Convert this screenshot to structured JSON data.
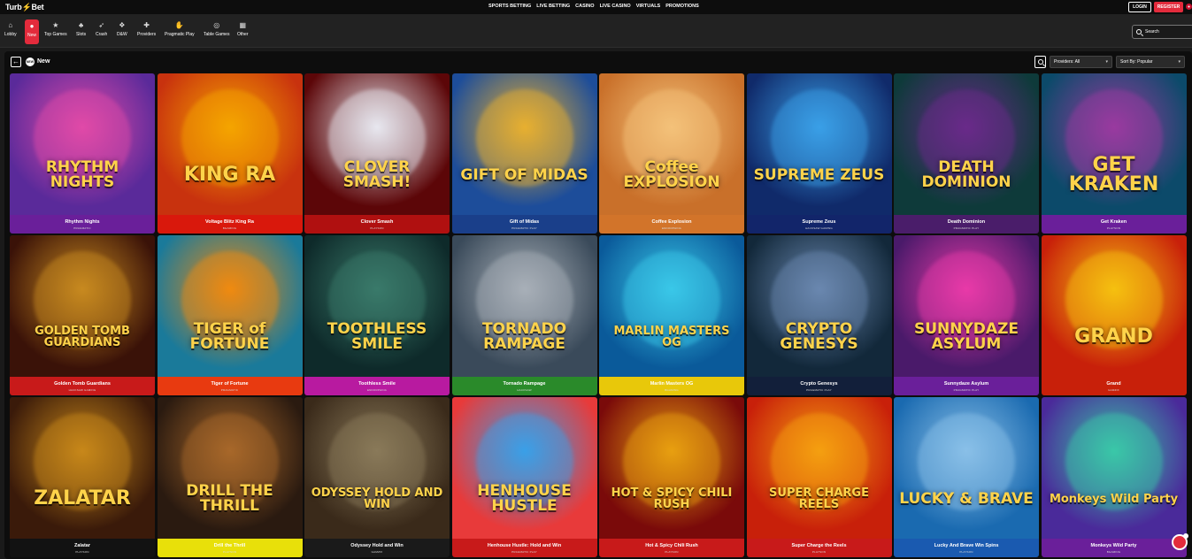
{
  "brand": {
    "name_a": "Turb",
    "name_b": "Bet"
  },
  "topnav": [
    "SPORTS BETTING",
    "LIVE BETTING",
    "CASINO",
    "LIVE CASINO",
    "VIRTUALS",
    "PROMOTIONS"
  ],
  "auth": {
    "login": "LOGIN",
    "register": "REGISTER"
  },
  "categories": [
    {
      "label": "Lobby",
      "icon": "home-icon"
    },
    {
      "label": "New",
      "icon": "new-icon",
      "active": true
    },
    {
      "label": "Top Games",
      "icon": "star-icon"
    },
    {
      "label": "Slots",
      "icon": "slots-icon"
    },
    {
      "label": "Crash",
      "icon": "rocket-icon"
    },
    {
      "label": "D&W",
      "icon": "gift-icon"
    },
    {
      "label": "Providers",
      "icon": "providers-icon"
    },
    {
      "label": "Pragmatic Play",
      "icon": "pragmatic-icon"
    },
    {
      "label": "Table Games",
      "icon": "chip-icon"
    },
    {
      "label": "Other",
      "icon": "other-icon"
    }
  ],
  "search": {
    "placeholder": "Search"
  },
  "section": {
    "title": "New",
    "badge": "NEW"
  },
  "filters": {
    "providers": "Providers: All",
    "sort": "Sort By: Popular"
  },
  "games": [
    {
      "name": "Rhythm Nights",
      "provider": "Pragmatic",
      "logo": "RHYTHM NIGHTS",
      "bg": "#5a2a9a",
      "bg2": "#e14aa8",
      "cap": "#6a1f9a"
    },
    {
      "name": "Voltage Blitz King Ra",
      "provider": "Bgaming",
      "logo": "KING RA",
      "bg": "#c8320e",
      "bg2": "#f5a500",
      "cap": "#d9180c"
    },
    {
      "name": "Clover Smash",
      "provider": "Playson",
      "logo": "CLOVER SMASH!",
      "bg": "#5c0608",
      "bg2": "#e8e8f0",
      "cap": "#b01010"
    },
    {
      "name": "Gift of Midas",
      "provider": "Pragmatic Play",
      "logo": "GIFT OF MIDAS",
      "bg": "#1d4d9a",
      "bg2": "#e8b030",
      "cap": "#1a3f8a"
    },
    {
      "name": "Coffee Explosion",
      "provider": "Endorphina",
      "logo": "Coffee EXPLOSION",
      "bg": "#c9702a",
      "bg2": "#f4c27a",
      "cap": "#d2742a"
    },
    {
      "name": "Supreme Zeus",
      "provider": "Hacksaw Gaming",
      "logo": "SUPREME ZEUS",
      "bg": "#102a6a",
      "bg2": "#3aa0e8",
      "cap": "#12256a"
    },
    {
      "name": "Death Dominion",
      "provider": "Pragmatic Play",
      "logo": "DEATH DOMINION",
      "bg": "#0e3a3a",
      "bg2": "#6a2a8a",
      "cap": "#4a1d6a"
    },
    {
      "name": "Get Kraken",
      "provider": "Playson",
      "logo": "GET KRAKEN",
      "bg": "#0c4a6a",
      "bg2": "#9a3aa0",
      "cap": "#6a1f9a"
    },
    {
      "name": "Golden Tomb Guardians",
      "provider": "Hacksaw Gaming",
      "logo": "GOLDEN TOMB GUARDIANS",
      "bg": "#3a1208",
      "bg2": "#c88a20",
      "cap": "#c81a1a"
    },
    {
      "name": "Tiger of Fortune",
      "provider": "Pragmatic",
      "logo": "TIGER of FORTUNE",
      "bg": "#1a7a9a",
      "bg2": "#f08a10",
      "cap": "#e83a10"
    },
    {
      "name": "Toothless Smile",
      "provider": "Endorphina",
      "logo": "TOOTHLESS SMILE",
      "bg": "#0e2a2a",
      "bg2": "#3a7a6a",
      "cap": "#b81aa0"
    },
    {
      "name": "Tornado Rampage",
      "provider": "Hacksaw",
      "logo": "TORNADO RAMPAGE",
      "bg": "#3a4a5a",
      "bg2": "#a8b0b8",
      "cap": "#2a8a2a"
    },
    {
      "name": "Marlin Masters OG",
      "provider": "Bgaming",
      "logo": "MARLIN MASTERS OG",
      "bg": "#0a5a9a",
      "bg2": "#3ac8e8",
      "cap": "#e8c80a"
    },
    {
      "name": "Crypto Genesys",
      "provider": "Pragmatic Play",
      "logo": "CRYPTO GENESYS",
      "bg": "#12283a",
      "bg2": "#6a88b0",
      "cap": "#121f3a"
    },
    {
      "name": "Sunnydaze Asylum",
      "provider": "Pragmatic Play",
      "logo": "SUNNYDAZE ASYLUM",
      "bg": "#4a1a6a",
      "bg2": "#e83aa8",
      "cap": "#6a1f9a"
    },
    {
      "name": "Grand",
      "provider": "Gamzix",
      "logo": "GRAND",
      "bg": "#c8200a",
      "bg2": "#f5c010",
      "cap": "#c8200a"
    },
    {
      "name": "Zalatar",
      "provider": "Playson",
      "logo": "ZALATAR",
      "bg": "#3a1a0a",
      "bg2": "#c8881a",
      "cap": "#121212"
    },
    {
      "name": "Drill the Thrill",
      "provider": "Playson",
      "logo": "DRILL THE THRILL",
      "bg": "#2a1a10",
      "bg2": "#a8682a",
      "cap": "#e8e00a"
    },
    {
      "name": "Odyssey Hold and Win",
      "provider": "Gamzix",
      "logo": "ODYSSEY HOLD AND WIN",
      "bg": "#3a2a1a",
      "bg2": "#8a7a5a",
      "cap": "#1a1a1a"
    },
    {
      "name": "Henhouse Hustle: Hold and Win",
      "provider": "Pragmatic Play",
      "logo": "HENHOUSE HUSTLE",
      "bg": "#e83a3a",
      "bg2": "#3aa0e8",
      "cap": "#c81a1a"
    },
    {
      "name": "Hot & Spicy Chili Rush",
      "provider": "Playson",
      "logo": "HOT & SPICY CHILI RUSH",
      "bg": "#7a0a0a",
      "bg2": "#e8a010",
      "cap": "#c81a1a"
    },
    {
      "name": "Super Charge the Reels",
      "provider": "Playson",
      "logo": "SUPER CHARGE REELS",
      "bg": "#c8200a",
      "bg2": "#f5a010",
      "cap": "#c81a1a"
    },
    {
      "name": "Lucky And Brave Win Spins",
      "provider": "Playson",
      "logo": "LUCKY & BRAVE",
      "bg": "#1a6ab0",
      "bg2": "#8ac0e8",
      "cap": "#1a5ab0"
    },
    {
      "name": "Monkeys Wild Party",
      "provider": "Bgaming",
      "logo": "Monkeys Wild Party",
      "bg": "#4a2a9a",
      "bg2": "#3ac8a8",
      "cap": "#6a1f9a"
    }
  ]
}
